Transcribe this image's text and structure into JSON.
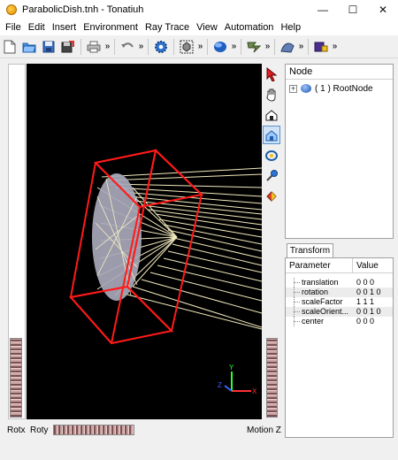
{
  "window": {
    "title": "ParabolicDish.tnh - Tonatiuh",
    "controls": {
      "minimize": "—",
      "maximize": "☐",
      "close": "✕"
    }
  },
  "menu": [
    "File",
    "Edit",
    "Insert",
    "Environment",
    "Ray Trace",
    "View",
    "Automation",
    "Help"
  ],
  "toolbar": {
    "icons": [
      "new-file-icon",
      "open-folder-icon",
      "save-disk-icon",
      "save-as-icon",
      "print-icon",
      "undo-icon",
      "settings-gear-icon",
      "selection-node-icon",
      "sphere-node-icon",
      "flux-icon",
      "surface-icon",
      "export-icon"
    ],
    "overflow_label": "»"
  },
  "viewer": {
    "left_wheel_label": "Rotx",
    "bottom_wheel_label": "Roty",
    "right_wheel_label": "Motion Z",
    "side_tools": [
      "pick-arrow-icon",
      "pan-hand-icon",
      "home-icon",
      "view-all-icon",
      "camera-rotate-icon",
      "seek-icon",
      "view-toggle-icon"
    ],
    "axes": {
      "x": "X",
      "y": "Y",
      "z": "Z"
    }
  },
  "scene_tree": {
    "header": "Node",
    "nodes": [
      {
        "expander": "+",
        "label": "( 1 ) RootNode"
      }
    ]
  },
  "properties": {
    "tab": "Transform",
    "columns": [
      "Parameter",
      "Value"
    ],
    "rows": [
      {
        "name": "translation",
        "value": "0 0 0"
      },
      {
        "name": "rotation",
        "value": "0 0 1 0"
      },
      {
        "name": "scaleFactor",
        "value": "1 1 1"
      },
      {
        "name": "scaleOrient...",
        "value": "0 0 1 0"
      },
      {
        "name": "center",
        "value": "0 0 0"
      }
    ]
  },
  "colors": {
    "viewport_bg": "#000000",
    "bounding_box": "#ff1a1a",
    "rays": "#fff7c8",
    "dish": "#a8a8ba",
    "axis_x": "#ff3030",
    "axis_y": "#30ff30",
    "axis_z": "#4060ff"
  }
}
